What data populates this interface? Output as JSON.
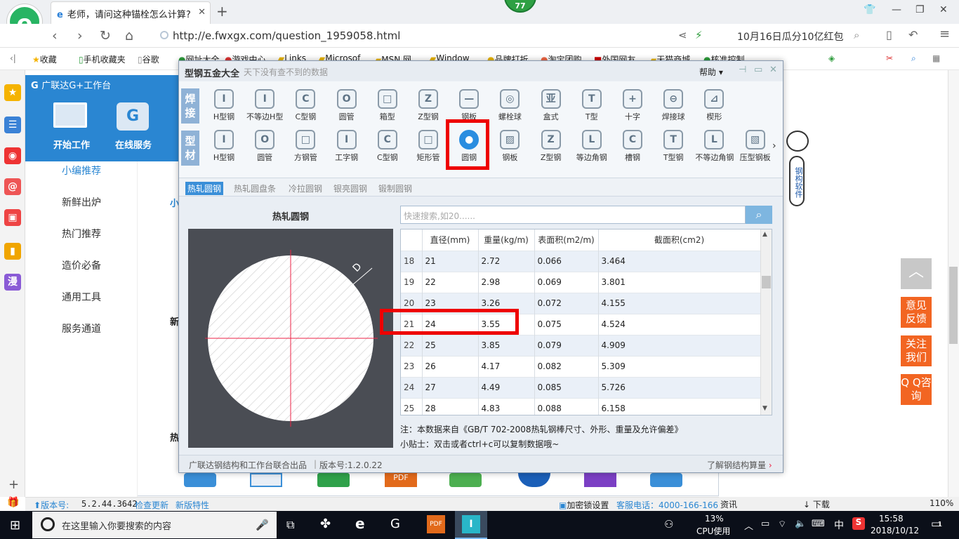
{
  "browser": {
    "logo": "e",
    "tab_title": "老师，请问这种锚栓怎么计算?",
    "tab_icon": "e",
    "badge": "77",
    "url": "http://e.fwxgx.com/question_1959058.html",
    "promo": "10月16日瓜分10亿红包",
    "bookmarks": [
      "收藏",
      "手机收藏夹",
      "谷歌",
      "网址大全",
      "游戏中心",
      "Links",
      "Microsof",
      "MSN 网",
      "Window",
      "品牌打折",
      "淘宝团购",
      "外国网友",
      "天猫商城",
      "核准控制"
    ],
    "status_right": [
      "资讯",
      "下载",
      "110%"
    ]
  },
  "gld": {
    "title": "广联达G+工作台",
    "buttons": [
      "开始工作",
      "在线服务"
    ],
    "menu": [
      "小编推荐",
      "新鲜出炉",
      "热门推荐",
      "造价必备",
      "通用工具",
      "服务通道"
    ],
    "partial_text": [
      "小",
      "新",
      "热"
    ],
    "version_label": "版本号:",
    "version": "5.2.44.3642",
    "check_update": "检查更新",
    "new_features": "新版特性",
    "lock_settings": "加密锁设置",
    "hotline": "客服电话：4000-166-166"
  },
  "float_buttons": [
    "意见反馈",
    "关注我们",
    "Q Q咨询"
  ],
  "dialog": {
    "title": "型钢五金大全",
    "subtitle": "天下没有查不到的数据",
    "help": "帮助",
    "group1": "焊接",
    "group2": "型材",
    "row1": [
      "H型钢",
      "不等边H型",
      "C型钢",
      "圆管",
      "箱型",
      "Z型钢",
      "钢板",
      "螺栓球",
      "盒式",
      "T型",
      "十字",
      "焊接球",
      "楔形"
    ],
    "row2": [
      "H型钢",
      "圆管",
      "方钢管",
      "工字钢",
      "C型钢",
      "矩形管",
      "圆钢",
      "钢板",
      "Z型钢",
      "等边角钢",
      "槽钢",
      "T型钢",
      "不等边角钢",
      "压型钢板"
    ],
    "subtabs": [
      "热轧圆钢",
      "热轧圆盘条",
      "冷拉圆钢",
      "银亮圆钢",
      "锻制圆钢"
    ],
    "left_title": "热轧圆钢",
    "dim_label": "D",
    "search_placeholder": "快速搜索,如20......",
    "headers": [
      "直径(mm)",
      "重量(kg/m)",
      "表面积(m2/m)",
      "截面积(cm2)"
    ],
    "rows": [
      [
        "18",
        "21",
        "2.72",
        "0.066",
        "3.464"
      ],
      [
        "19",
        "22",
        "2.98",
        "0.069",
        "3.801"
      ],
      [
        "20",
        "23",
        "3.26",
        "0.072",
        "4.155"
      ],
      [
        "21",
        "24",
        "3.55",
        "0.075",
        "4.524"
      ],
      [
        "22",
        "25",
        "3.85",
        "0.079",
        "4.909"
      ],
      [
        "23",
        "26",
        "4.17",
        "0.082",
        "5.309"
      ],
      [
        "24",
        "27",
        "4.49",
        "0.085",
        "5.726"
      ],
      [
        "25",
        "28",
        "4.83",
        "0.088",
        "6.158"
      ]
    ],
    "note": "注：本数据来自《GB/T 702-2008热轧钢棒尺寸、外形、重量及允许偏差》",
    "tip": "小贴士：双击或者ctrl+c可以复制数据哦~",
    "footer_left": "广联达钢结构和工作台联合出品",
    "footer_version": "版本号:1.2.0.22",
    "footer_right": "了解钢结构算量",
    "mascot_text": "钢构软件"
  },
  "taskbar": {
    "search_placeholder": "在这里输入你要搜索的内容",
    "cpu_percent": "13%",
    "cpu_label": "CPU使用",
    "ime": "中",
    "time": "15:58",
    "date": "2018/10/12",
    "notify_count": "1"
  },
  "colors": {
    "accent": "#2a86d2",
    "highlight": "#ee0000",
    "orange": "#f26522"
  }
}
